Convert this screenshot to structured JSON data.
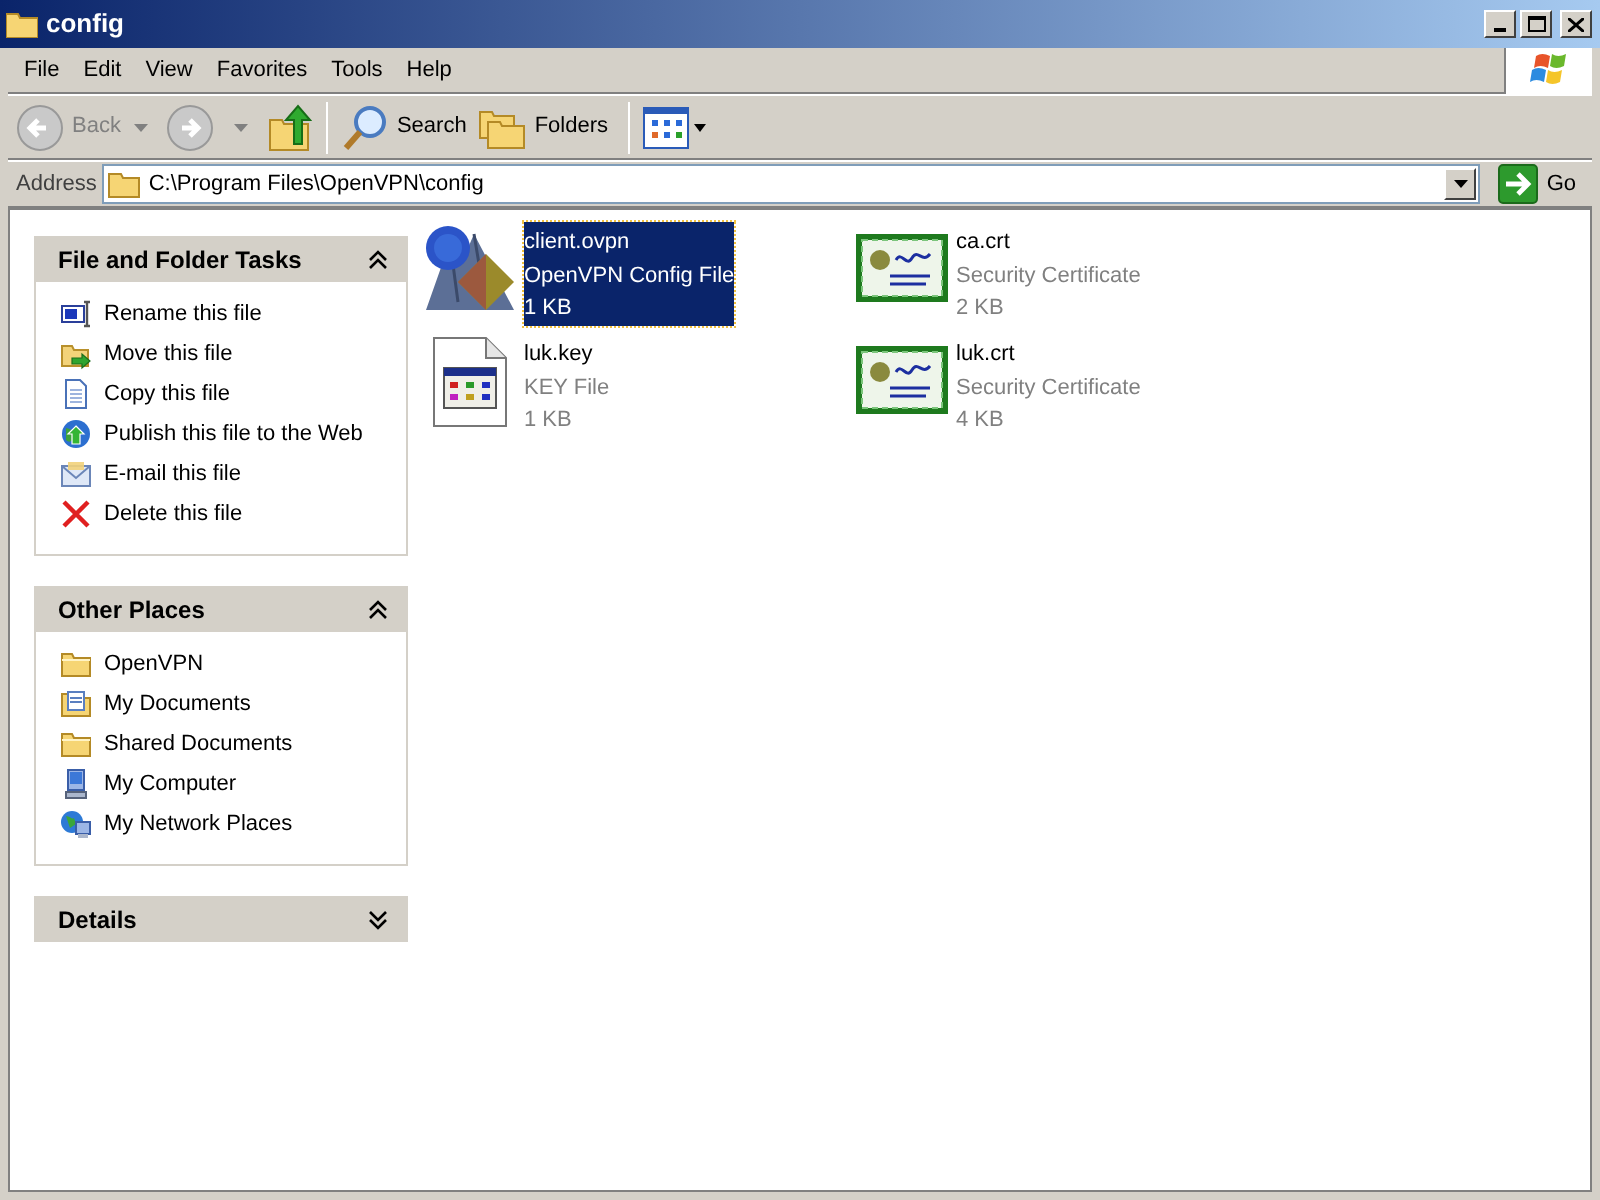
{
  "window": {
    "title": "config"
  },
  "menu": [
    "File",
    "Edit",
    "View",
    "Favorites",
    "Tools",
    "Help"
  ],
  "toolbar": {
    "back": "Back",
    "search": "Search",
    "folders": "Folders"
  },
  "address": {
    "label": "Address",
    "value": "C:\\Program Files\\OpenVPN\\config",
    "go": "Go"
  },
  "panels": [
    {
      "title": "File and Folder Tasks",
      "expanded": true,
      "items": [
        {
          "label": "Rename this file",
          "kind": "rename"
        },
        {
          "label": "Move this file",
          "kind": "move"
        },
        {
          "label": "Copy this file",
          "kind": "copy"
        },
        {
          "label": "Publish this file to the Web",
          "kind": "publish"
        },
        {
          "label": "E-mail this file",
          "kind": "mail"
        },
        {
          "label": "Delete this file",
          "kind": "delete"
        }
      ]
    },
    {
      "title": "Other Places",
      "expanded": true,
      "items": [
        {
          "label": "OpenVPN",
          "kind": "folder"
        },
        {
          "label": "My Documents",
          "kind": "documents"
        },
        {
          "label": "Shared Documents",
          "kind": "folder"
        },
        {
          "label": "My Computer",
          "kind": "computer"
        },
        {
          "label": "My Network Places",
          "kind": "network"
        }
      ]
    },
    {
      "title": "Details",
      "expanded": false
    }
  ],
  "files": [
    {
      "name": "client.ovpn",
      "type": "OpenVPN Config File",
      "size": "1 KB",
      "kind": "config",
      "selected": true
    },
    {
      "name": "ca.crt",
      "type": "Security Certificate",
      "size": "2 KB",
      "kind": "certificate",
      "selected": false
    },
    {
      "name": "luk.key",
      "type": "KEY File",
      "size": "1 KB",
      "kind": "key",
      "selected": false
    },
    {
      "name": "luk.crt",
      "type": "Security Certificate",
      "size": "4 KB",
      "kind": "certificate",
      "selected": false
    }
  ]
}
